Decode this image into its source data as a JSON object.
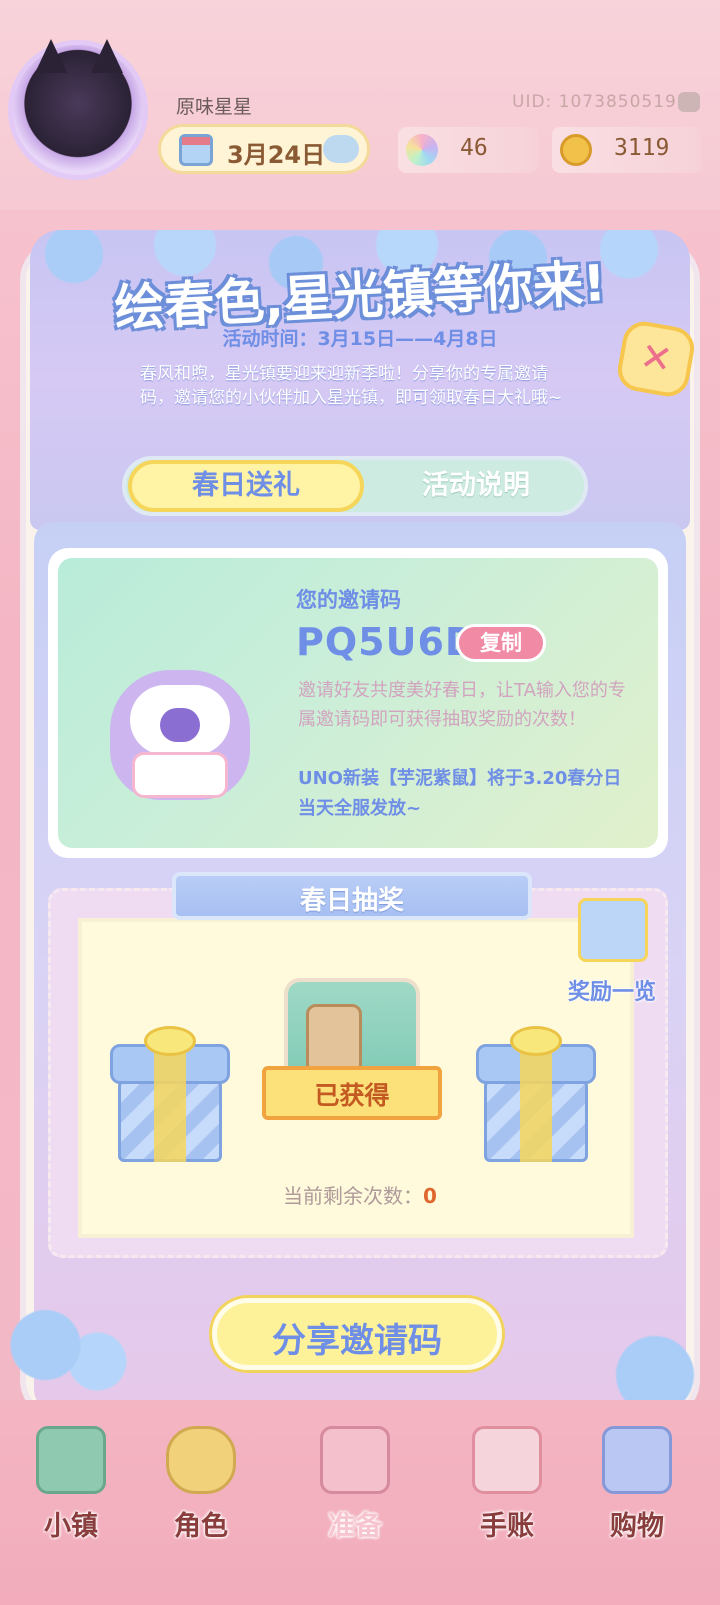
{
  "header": {
    "username": "原味星星",
    "uid": "UID: 1073850519",
    "date": "3月24日",
    "gems": "46",
    "coins": "3119"
  },
  "event": {
    "title": "绘春色,星光镇等你来!",
    "time": "活动时间：3月15日——4月8日",
    "description": "春风和煦，星光镇要迎来迎新季啦！分享你的专属邀请码，邀请您的小伙伴加入星光镇，即可领取春日大礼哦~",
    "close_icon": "close-icon"
  },
  "tabs": [
    {
      "label": "春日送礼",
      "active": true
    },
    {
      "label": "活动说明",
      "active": false
    }
  ],
  "invite": {
    "label": "您的邀请码",
    "code": "PQ5U6D",
    "copy_label": "复制",
    "description": "邀请好友共度美好春日，让TA输入您的专属邀请码即可获得抽取奖励的次数！",
    "note": "UNO新装【芋泥紫鼠】将于3.20春分日当天全服发放~"
  },
  "lottery": {
    "title": "春日抽奖",
    "rewards_label": "奖励一览",
    "obtained_label": "已获得",
    "remaining_label": "当前剩余次数：",
    "remaining_count": "0"
  },
  "share_button": "分享邀请码",
  "nav": [
    {
      "label": "小镇",
      "icon": "map-icon"
    },
    {
      "label": "角色",
      "icon": "character-icon"
    },
    {
      "label": "准备",
      "icon": "prepare-icon"
    },
    {
      "label": "手账",
      "icon": "journal-icon"
    },
    {
      "label": "购物",
      "icon": "shopping-bag-icon"
    }
  ],
  "colors": {
    "accent_blue": "#6f8ee6",
    "copy_pink": "#f08aa5",
    "highlight_yellow": "#fff3a6"
  }
}
